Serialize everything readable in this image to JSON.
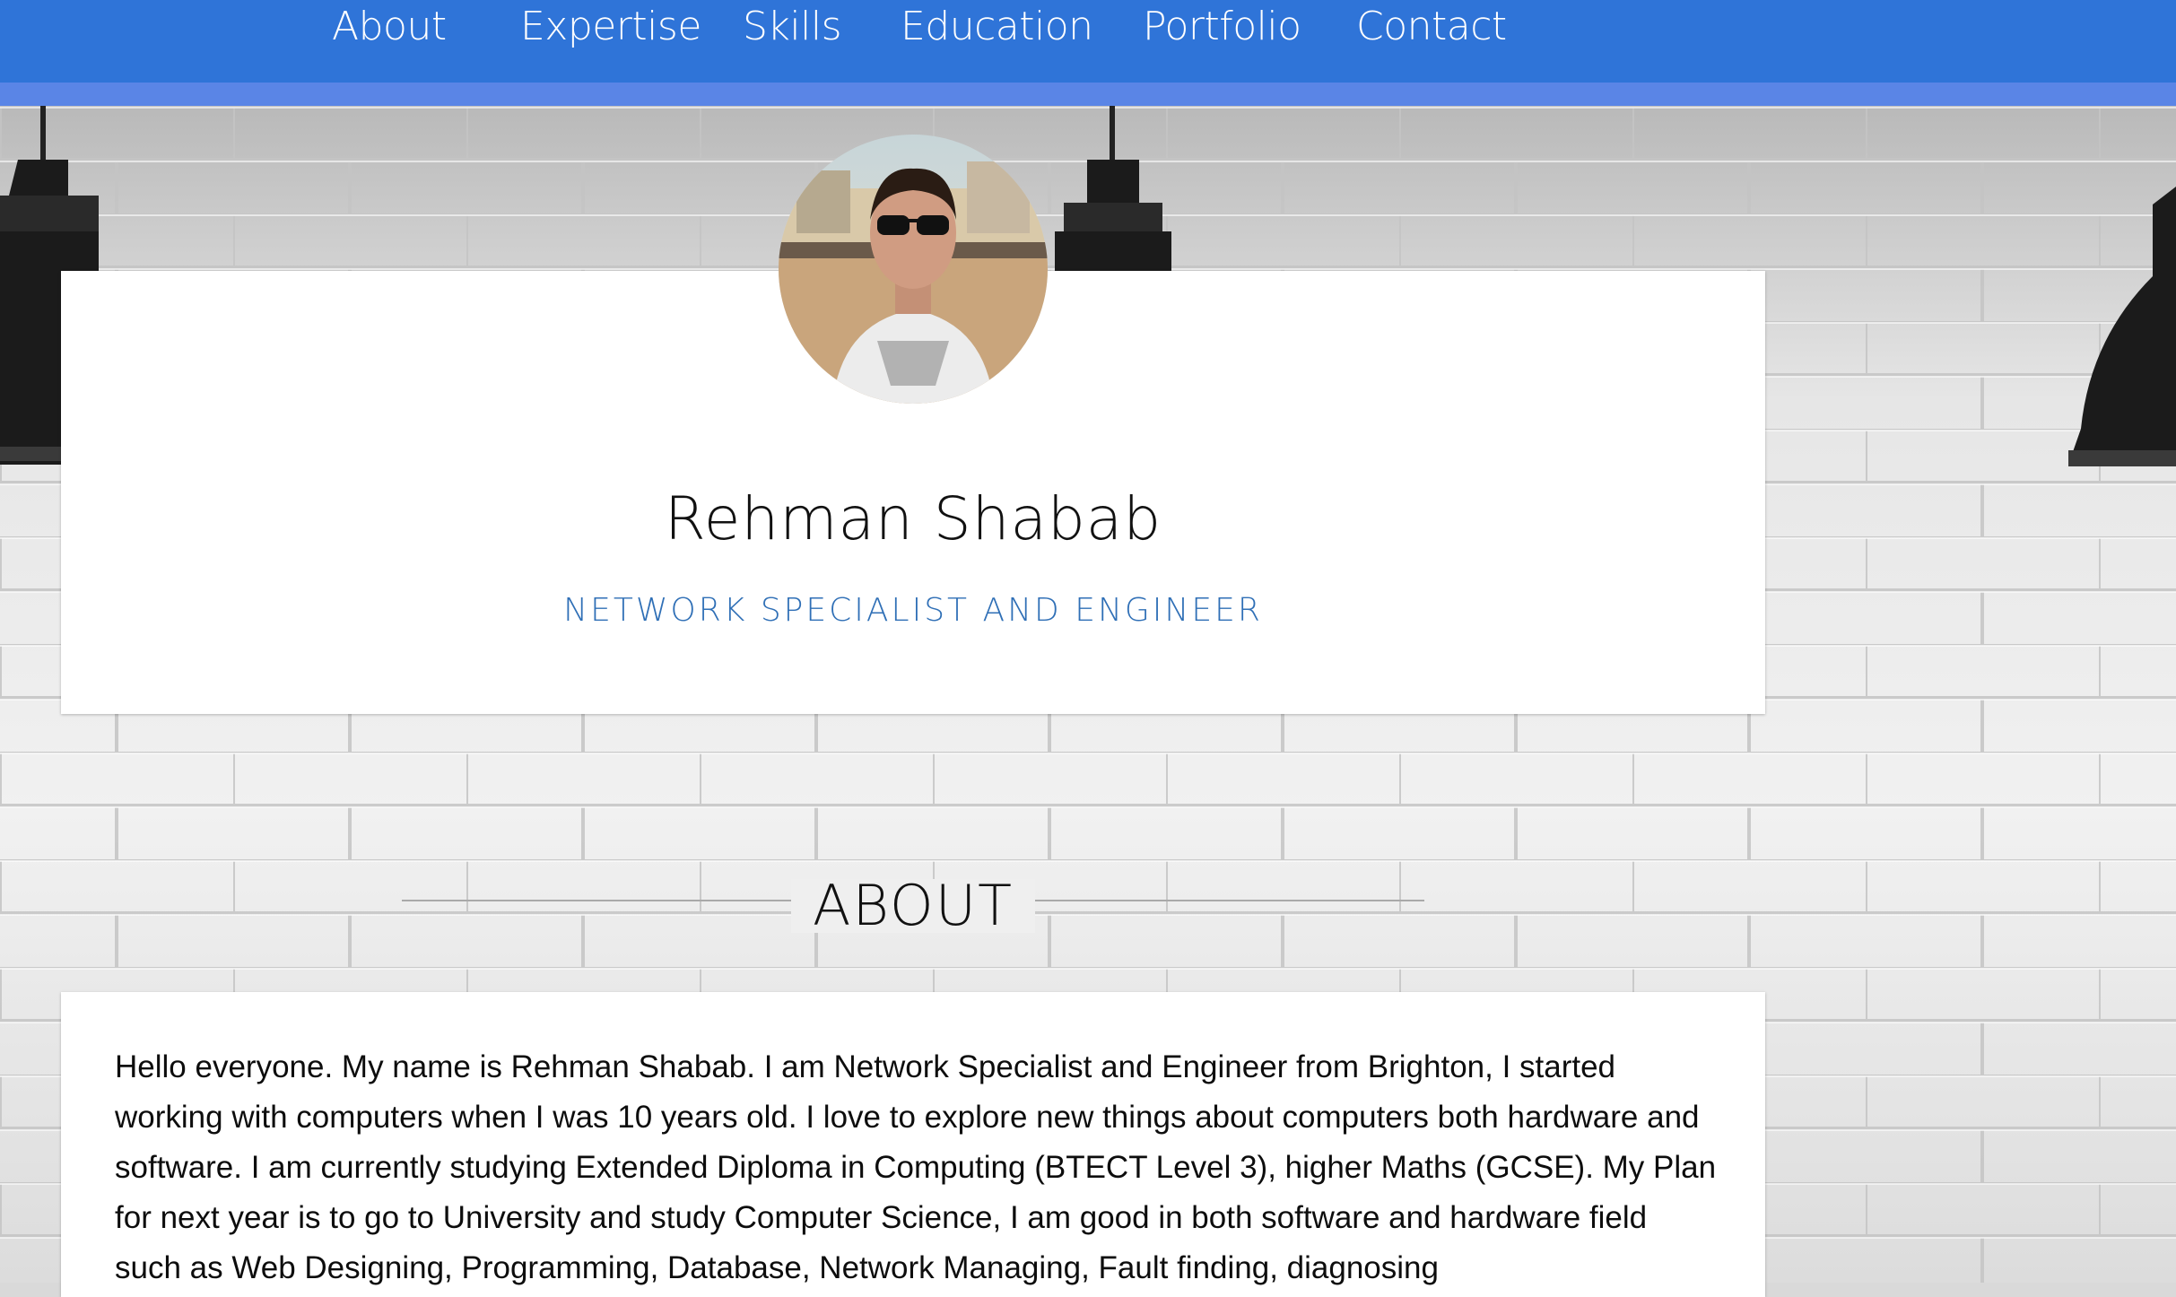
{
  "nav": {
    "items": [
      {
        "label": "About"
      },
      {
        "label": "Expertise"
      },
      {
        "label": "Skills"
      },
      {
        "label": "Education"
      },
      {
        "label": "Portfolio"
      },
      {
        "label": "Contact"
      }
    ]
  },
  "profile": {
    "name": "Rehman Shabab",
    "title": "NETWORK SPECIALIST AND ENGINEER"
  },
  "about": {
    "heading": "ABOUT",
    "text": "Hello everyone. My name is Rehman Shabab. I am Network Specialist and Engineer from Brighton, I started working with computers when I was 10 years old. I love to explore new things about computers both hardware and software. I am currently studying Extended Diploma in Computing (BTECT Level 3), higher Maths (GCSE). My Plan for next year is to go to University and study Computer Science, I am good in both software and hardware field such as Web Designing, Programming, Database, Network Managing, Fault finding, diagnosing"
  },
  "colors": {
    "nav_bg": "#2f74d8",
    "nav_underline": "#5a85e6",
    "title_accent": "#2f6fb6"
  },
  "icons": {
    "avatar": "profile-photo"
  }
}
